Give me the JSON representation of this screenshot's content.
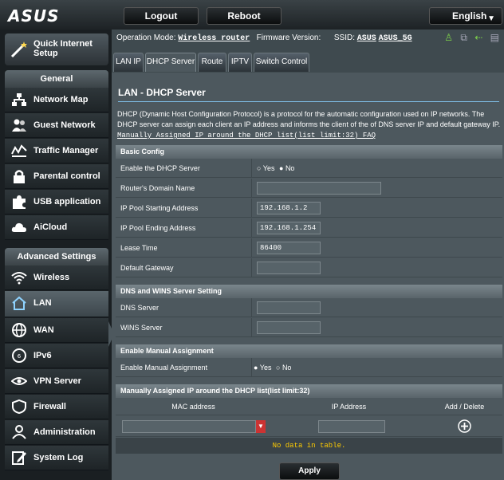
{
  "topbar": {
    "logo": "ASUS",
    "logout": "Logout",
    "reboot": "Reboot",
    "language": "English"
  },
  "sidebar": {
    "qis_label": "Quick Internet Setup",
    "general_header": "General",
    "general_items": [
      "Network Map",
      "Guest Network",
      "Traffic Manager",
      "Parental control",
      "USB application",
      "AiCloud"
    ],
    "advanced_header": "Advanced Settings",
    "advanced_items": [
      "Wireless",
      "LAN",
      "WAN",
      "IPv6",
      "VPN Server",
      "Firewall",
      "Administration",
      "System Log"
    ],
    "active_item": "LAN"
  },
  "status": {
    "operation_mode_label": "Operation Mode:",
    "operation_mode_value": "Wireless router",
    "firmware_label": "Firmware Version:",
    "ssid_label": "SSID:",
    "ssid1": "ASUS",
    "ssid2": "ASUS_5G"
  },
  "tabs": [
    "LAN IP",
    "DHCP Server",
    "Route",
    "IPTV",
    "Switch Control"
  ],
  "active_tab": "DHCP Server",
  "page": {
    "title": "LAN - DHCP Server",
    "description": "DHCP (Dynamic Host Configuration Protocol) is a protocol for the automatic configuration used on IP networks. The DHCP server can assign each client an IP address and informs the client of the of DNS server IP and default gateway IP.",
    "faq_link": "Manually Assigned IP around the DHCP list(list limit:32) FAQ"
  },
  "basic_config": {
    "header": "Basic Config",
    "enable_dhcp_label": "Enable the DHCP Server",
    "yes": "Yes",
    "no": "No",
    "domain_name_label": "Router's Domain Name",
    "domain_name_value": "",
    "pool_start_label": "IP Pool Starting Address",
    "pool_start_value": "192.168.1.2",
    "pool_end_label": "IP Pool Ending Address",
    "pool_end_value": "192.168.1.254",
    "lease_label": "Lease Time",
    "lease_value": "86400",
    "gateway_label": "Default Gateway",
    "gateway_value": ""
  },
  "dns_wins": {
    "header": "DNS and WINS Server Setting",
    "dns_label": "DNS Server",
    "dns_value": "",
    "wins_label": "WINS Server",
    "wins_value": ""
  },
  "manual_assign": {
    "header": "Enable Manual Assignment",
    "label": "Enable Manual Assignment",
    "yes": "Yes",
    "no": "No"
  },
  "manual_list": {
    "header": "Manually Assigned IP around the DHCP list(list limit:32)",
    "col_mac": "MAC address",
    "col_ip": "IP Address",
    "col_action": "Add / Delete",
    "empty_text": "No data in table."
  },
  "apply_label": "Apply",
  "colors": {
    "accent_blue": "#7fbee6",
    "empty_text": "#ffcc00",
    "panel": "#4d585e"
  }
}
